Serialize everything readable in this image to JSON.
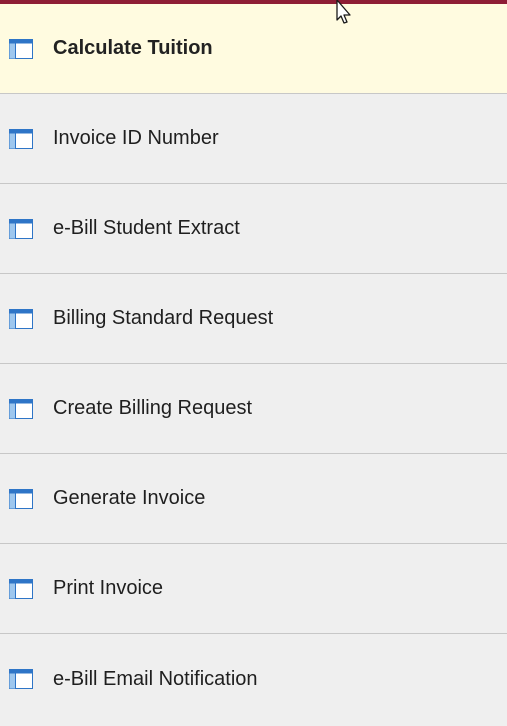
{
  "menu": {
    "items": [
      {
        "label": "Calculate Tuition",
        "active": true
      },
      {
        "label": "Invoice ID Number",
        "active": false
      },
      {
        "label": "e-Bill Student Extract",
        "active": false
      },
      {
        "label": "Billing Standard Request",
        "active": false
      },
      {
        "label": "Create Billing Request",
        "active": false
      },
      {
        "label": "Generate Invoice",
        "active": false
      },
      {
        "label": "Print Invoice",
        "active": false
      },
      {
        "label": "e-Bill Email Notification",
        "active": false
      }
    ]
  },
  "colors": {
    "top_border": "#8e1d35",
    "active_bg": "#fffbe0",
    "item_bg": "#efefef",
    "divider": "#c7c7c7",
    "icon_blue": "#2e75c7"
  },
  "icons": {
    "item_icon": "table-page-icon",
    "cursor": "mouse-pointer-icon"
  }
}
